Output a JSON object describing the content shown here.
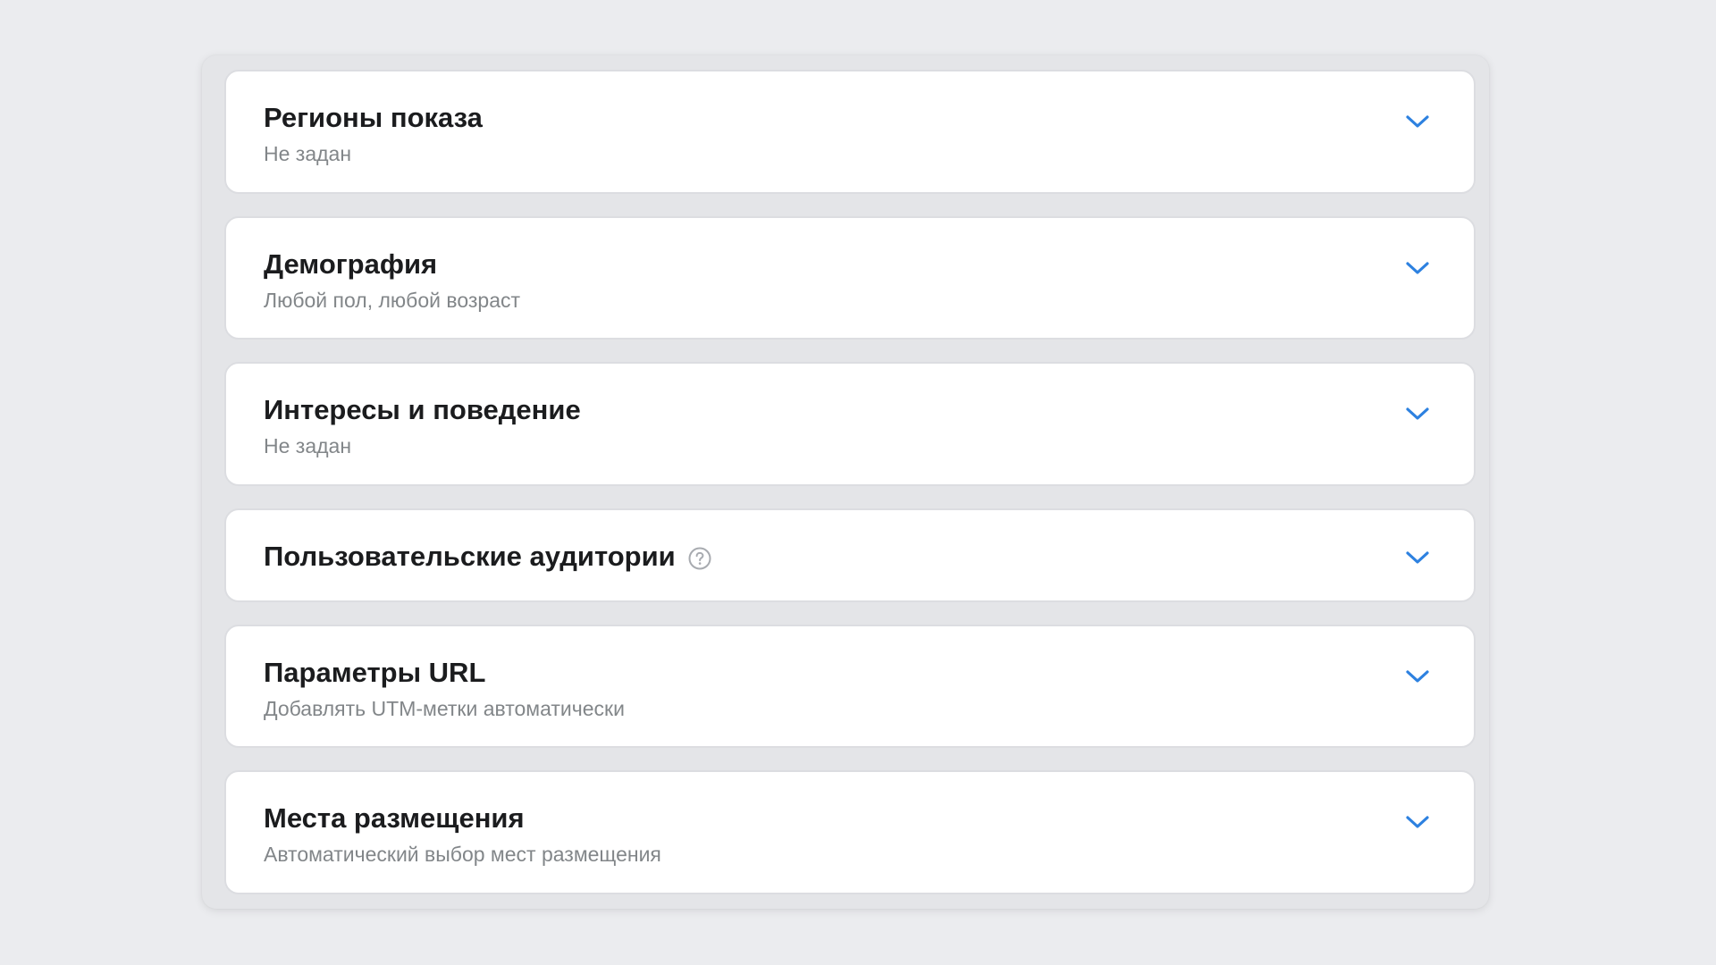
{
  "sections": [
    {
      "title": "Регионы показа",
      "subtitle": "Не задан",
      "icon": "chevron-down-icon"
    },
    {
      "title": "Демография",
      "subtitle": "Любой пол, любой возраст",
      "icon": "chevron-down-icon"
    },
    {
      "title": "Интересы и поведение",
      "subtitle": "Не задан",
      "icon": "chevron-down-icon"
    },
    {
      "title": "Пользовательские аудитории",
      "subtitle": "",
      "icon": "chevron-down-icon",
      "help_icon": "question-circle-icon"
    },
    {
      "title": "Параметры URL",
      "subtitle": "Добавлять UTM-метки автоматически",
      "icon": "chevron-down-icon"
    },
    {
      "title": "Места размещения",
      "subtitle": "Автоматический выбор мест размещения",
      "icon": "chevron-down-icon"
    }
  ],
  "colors": {
    "accent": "#2d81e0",
    "background": "#ebecef",
    "card": "#ffffff",
    "title": "#1b1c1e",
    "subtitle": "#828689",
    "help_icon": "#a8abb0"
  }
}
